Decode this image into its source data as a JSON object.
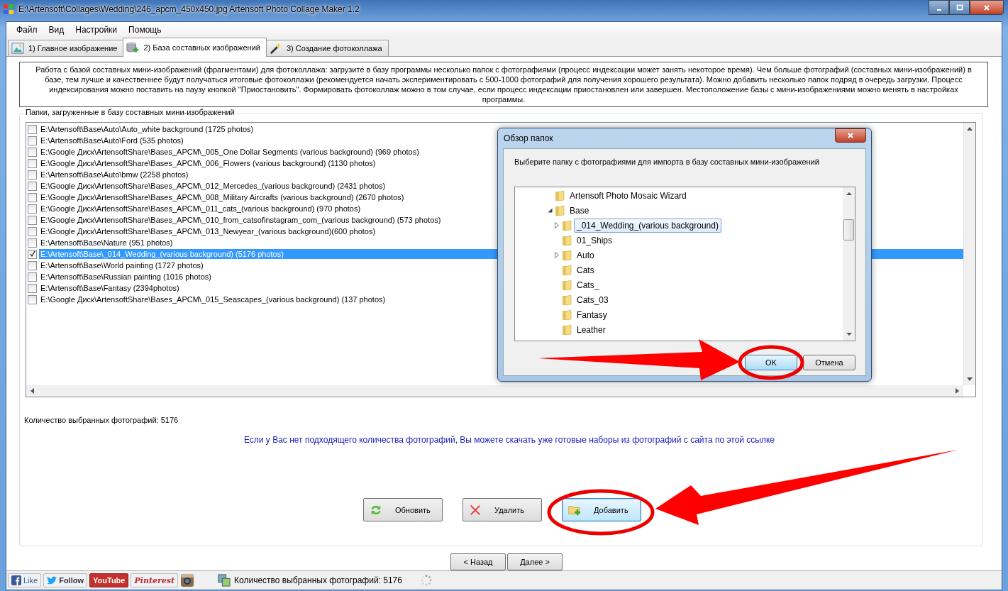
{
  "window": {
    "title": "E:\\Artensoft\\Collages\\Wedding\\246_apcm_450x450.jpg Artensoft Photo Collage Maker 1.2"
  },
  "menu": [
    "Файл",
    "Вид",
    "Настройки",
    "Помощь"
  ],
  "tabs": [
    {
      "label": "1) Главное изображение",
      "selected": false,
      "kind": "image"
    },
    {
      "label": "2) База составных изображений",
      "selected": true,
      "kind": "database"
    },
    {
      "label": "3) Создание фотоколлажа",
      "selected": false,
      "kind": "wand"
    }
  ],
  "description": "Работа с базой составных мини-изображений (фрагментами) для фотоколлажа: загрузите в базу программы несколько папок с фотографиями (процесс индексации может занять некоторое время). Чем больше фотографий (составных мини-изображений) в базе, тем лучше и качественнее будут получаться итоговые фотоколлажи (рекомендуется начать экспериментировать с 500-1000 фотографий для получения хорошего результата). Можно добавить несколько папок подряд в очередь загрузки. Процесс индексирования можно поставить на паузу кнопкой \"Приостановить\". Формировать фотоколлаж можно в том случае, если процесс индексации приостановлен или завершен. Местоположение базы с мини-изображениями можно менять в настройках программы.",
  "folders": {
    "legend": "Папки, загруженные в базу составных мини-изображений",
    "rows": [
      {
        "path": "E:\\Artensoft\\Base\\Auto\\Auto_white background (1725 photos)",
        "checked": false,
        "selected": false
      },
      {
        "path": "E:\\Artensoft\\Base\\Auto\\Ford (535 photos)",
        "checked": false,
        "selected": false
      },
      {
        "path": "E:\\Google Диск\\ArtensoftShare\\Bases_APCM\\_005_One Dollar Segments (various background) (969 photos)",
        "checked": false,
        "selected": false
      },
      {
        "path": "E:\\Google Диск\\ArtensoftShare\\Bases_APCM\\_006_Flowers (various background) (1130 photos)",
        "checked": false,
        "selected": false
      },
      {
        "path": "E:\\Artensoft\\Base\\Auto\\bmw (2258 photos)",
        "checked": false,
        "selected": false
      },
      {
        "path": "E:\\Google Диск\\ArtensoftShare\\Bases_APCM\\_012_Mercedes_(various background) (2431 photos)",
        "checked": false,
        "selected": false
      },
      {
        "path": "E:\\Google Диск\\ArtensoftShare\\Bases_APCM\\_008_Military Aircrafts (various background) (2670 photos)",
        "checked": false,
        "selected": false
      },
      {
        "path": "E:\\Google Диск\\ArtensoftShare\\Bases_APCM\\_011_cats_(various background) (970 photos)",
        "checked": false,
        "selected": false
      },
      {
        "path": "E:\\Google Диск\\ArtensoftShare\\Bases_APCM\\_010_from_catsofinstagram_com_(various background) (573 photos)",
        "checked": false,
        "selected": false
      },
      {
        "path": "E:\\Google Диск\\ArtensoftShare\\Bases_APCM\\_013_Newyear_(various background)(600 photos)",
        "checked": false,
        "selected": false
      },
      {
        "path": "E:\\Artensoft\\Base\\Nature (951 photos)",
        "checked": false,
        "selected": false
      },
      {
        "path": "E:\\Artensoft\\Base\\_014_Wedding_(various background) (5176 photos)",
        "checked": true,
        "selected": true
      },
      {
        "path": "E:\\Artensoft\\Base\\World painting (1727 photos)",
        "checked": false,
        "selected": false
      },
      {
        "path": "E:\\Artensoft\\Base\\Russian painting (1016 photos)",
        "checked": false,
        "selected": false
      },
      {
        "path": "E:\\Artensoft\\Base\\Fantasy (2394photos)",
        "checked": false,
        "selected": false
      },
      {
        "path": "E:\\Google Диск\\ArtensoftShare\\Bases_APCM\\_015_Seascapes_(various background) (137 photos)",
        "checked": false,
        "selected": false
      }
    ]
  },
  "selected_count": "Количество выбранных фотографий: 5176",
  "download_link": "Если у Вас нет подходящего количества фотографий, Вы можете скачать уже готовые наборы из фотографий с сайта по этой ссылке",
  "actions": [
    {
      "label": "Обновить",
      "kind": "refresh",
      "focused": false
    },
    {
      "label": "Удалить",
      "kind": "delete",
      "focused": false
    },
    {
      "label": "Добавить",
      "kind": "add",
      "focused": true
    }
  ],
  "nav": [
    "< Назад",
    "Далее >"
  ],
  "status_bar": {
    "social": [
      {
        "label": "Like",
        "kind": "facebook"
      },
      {
        "label": "Follow",
        "kind": "twitter"
      },
      {
        "label": "YouTube",
        "kind": "youtube"
      },
      {
        "label": "Pinterest",
        "kind": "pinterest"
      },
      {
        "kind": "instagram"
      }
    ],
    "text": "Количество выбранных фотографий: 5176"
  },
  "dialog": {
    "title": "Обзор папок",
    "prompt": "Выберите папку с фотографиями для импорта в базу составных мини-изображений",
    "tree": [
      {
        "label": "Artensoft Photo Mosaic Wizard",
        "kind": "leaf",
        "selected": false
      },
      {
        "label": "Base",
        "kind": "branch",
        "expanded": true,
        "selected": false,
        "children": [
          {
            "label": "_014_Wedding_(various background)",
            "kind": "branch",
            "expanded": false,
            "selected": true
          },
          {
            "label": "01_Ships",
            "kind": "leaf",
            "selected": false
          },
          {
            "label": "Auto",
            "kind": "branch",
            "expanded": false,
            "selected": false
          },
          {
            "label": "Cats",
            "kind": "leaf",
            "selected": false
          },
          {
            "label": "Cats_",
            "kind": "leaf",
            "selected": false
          },
          {
            "label": "Cats_03",
            "kind": "leaf",
            "selected": false
          },
          {
            "label": "Fantasy",
            "kind": "leaf",
            "selected": false
          },
          {
            "label": "Leather",
            "kind": "leaf",
            "selected": false
          }
        ]
      }
    ],
    "buttons": [
      {
        "label": "OK",
        "default": true
      },
      {
        "label": "Отмена",
        "default": false
      }
    ]
  }
}
